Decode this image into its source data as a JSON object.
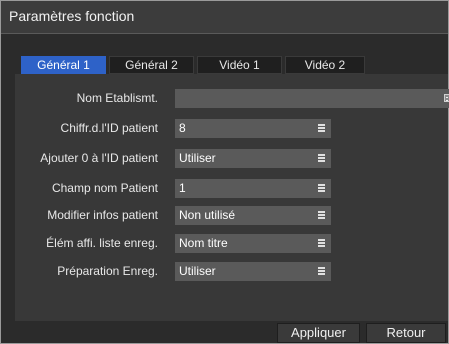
{
  "window": {
    "title": "Paramètres fonction"
  },
  "tabs": [
    {
      "label": "Général 1",
      "active": true
    },
    {
      "label": "Général 2",
      "active": false
    },
    {
      "label": "Vidéo 1",
      "active": false
    },
    {
      "label": "Vidéo 2",
      "active": false
    }
  ],
  "settings": [
    {
      "label": "Nom Etablismt.",
      "value": "",
      "icon": "keyboard-icon"
    },
    {
      "label": "Chiffr.d.l'ID patient",
      "value": "8",
      "icon": "menu-icon"
    },
    {
      "label": "Ajouter 0 à l'ID patient",
      "value": "Utiliser",
      "icon": "menu-icon"
    },
    {
      "label": "Champ nom Patient",
      "value": "1",
      "icon": "menu-icon"
    },
    {
      "label": "Modifier infos patient",
      "value": "Non utilisé",
      "icon": "menu-icon"
    },
    {
      "label": "Élém affi. liste enreg.",
      "value": "Nom titre",
      "icon": "menu-icon"
    },
    {
      "label": "Préparation Enreg.",
      "value": "Utiliser",
      "icon": "menu-icon"
    }
  ],
  "buttons": {
    "apply": "Appliquer",
    "back": "Retour"
  },
  "colors": {
    "active_tab": "#2e62c8",
    "field_bg": "#5a5a5a",
    "panel_bg": "#383838"
  }
}
